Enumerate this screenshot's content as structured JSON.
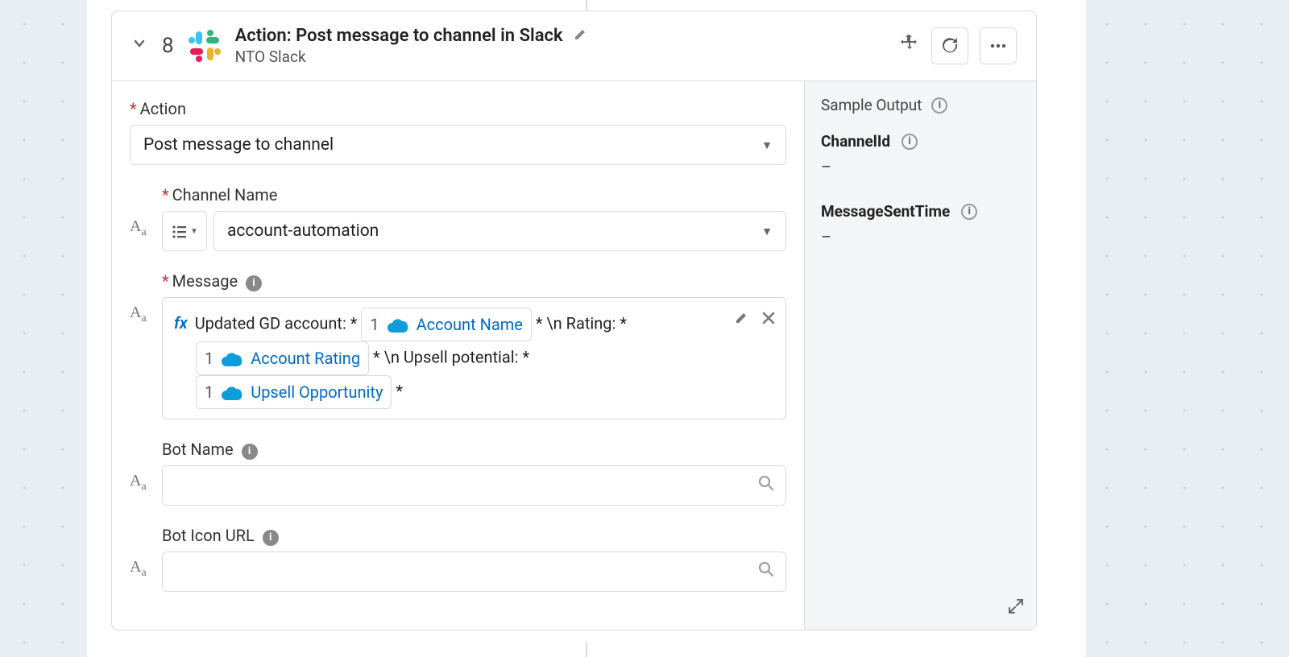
{
  "header": {
    "step": "8",
    "title": "Action: Post message to channel in Slack",
    "subtitle": "NTO Slack"
  },
  "fields": {
    "action": {
      "label": "Action",
      "value": "Post message to channel"
    },
    "channel": {
      "label": "Channel Name",
      "value": "account-automation"
    },
    "message": {
      "label": "Message",
      "prefix": "Updated GD account: *",
      "pill1_n": "1",
      "pill1_t": "Account Name",
      "seg1": "* \\n Rating: *",
      "pill2_n": "1",
      "pill2_t": "Account Rating",
      "seg2": "* \\n Upsell potential: *",
      "pill3_n": "1",
      "pill3_t": "Upsell Opportunity",
      "seg3": "*"
    },
    "botName": {
      "label": "Bot Name"
    },
    "botIcon": {
      "label": "Bot Icon URL"
    }
  },
  "output": {
    "title": "Sample Output",
    "k1": "ChannelId",
    "v1": "–",
    "k2": "MessageSentTime",
    "v2": "–"
  },
  "glyphs": {
    "fx": "fx",
    "Aa": "A",
    "Aa_sub": "a"
  }
}
